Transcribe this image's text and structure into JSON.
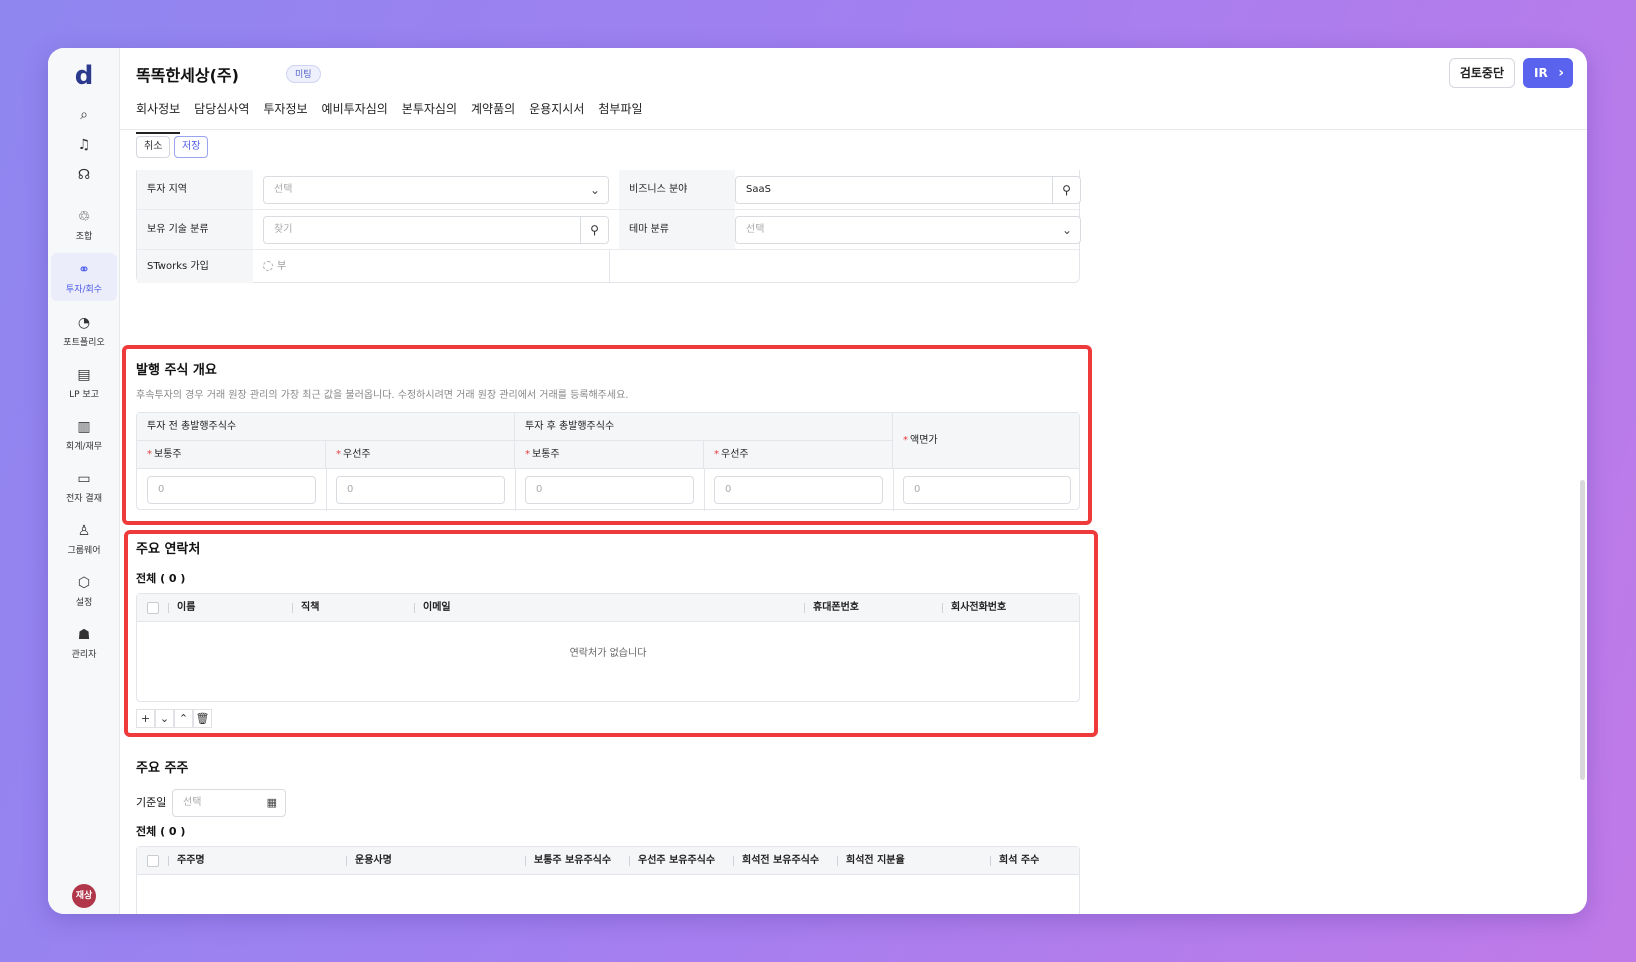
{
  "app": {
    "logo": "d"
  },
  "sidebar": {
    "top_icons": [
      {
        "name": "search-icon",
        "glyph": "⌕"
      },
      {
        "name": "bell-icon",
        "glyph": "♫"
      },
      {
        "name": "headset-icon",
        "glyph": "☊"
      }
    ],
    "items": [
      {
        "label": "조합",
        "glyph": "♲"
      },
      {
        "label": "투자/회수",
        "glyph": "⚭"
      },
      {
        "label": "포트폴리오",
        "glyph": "◔"
      },
      {
        "label": "LP 보고",
        "glyph": "▤"
      },
      {
        "label": "회계/재무",
        "glyph": "▥"
      },
      {
        "label": "전자 결재",
        "glyph": "▭"
      },
      {
        "label": "그룹웨어",
        "glyph": "♙"
      },
      {
        "label": "설정",
        "glyph": "⬡"
      },
      {
        "label": "관리자",
        "glyph": "☗"
      }
    ],
    "avatar": "재상"
  },
  "header": {
    "company": "똑똑한세상(주)",
    "badge": "미팅",
    "tabs": [
      "회사정보",
      "담당심사역",
      "투자정보",
      "예비투자심의",
      "본투자심의",
      "계약품의",
      "운용지시서",
      "첨부파일"
    ],
    "stop_button": "검토중단",
    "ir_button": "IR"
  },
  "actions": {
    "cancel": "취소",
    "save": "저장"
  },
  "form": {
    "region_label": "투자 지역",
    "region_placeholder": "선택",
    "business_label": "비즈니스 분야",
    "business_value": "SaaS",
    "tech_label": "보유 기술 분류",
    "tech_placeholder": "찾기",
    "theme_label": "테마 분류",
    "theme_placeholder": "선택",
    "stworks_label": "STworks 가입",
    "stworks_value": "부"
  },
  "shares": {
    "title": "발행 주식 개요",
    "desc": "후속투자의 경우 거래 원장 관리의 가장 최근 값을 불러옵니다. 수정하시려면 거래 원장 관리에서 거래를 등록해주세요.",
    "before_label": "투자 전 총발행주식수",
    "after_label": "투자 후 총발행주식수",
    "common": "보통주",
    "preferred": "우선주",
    "par_value": "액면가",
    "placeholder": "0"
  },
  "contacts": {
    "title": "주요 연락처",
    "count": "전체 ( 0 )",
    "columns": [
      "이름",
      "직책",
      "이메일",
      "휴대폰번호",
      "회사전화번호"
    ],
    "empty": "연락처가 없습니다"
  },
  "shareholders": {
    "title": "주요 주주",
    "date_label": "기준일",
    "date_placeholder": "선택",
    "count": "전체 ( 0 )",
    "columns": [
      "주주명",
      "운용사명",
      "보통주 보유주식수",
      "우선주 보유주식수",
      "희석전 보유주식수",
      "희석전 지분율",
      "희석 주수"
    ]
  },
  "colors": {
    "accent": "#5a63ee",
    "highlight": "#ee3a3a",
    "avatar": "#b1364a"
  }
}
